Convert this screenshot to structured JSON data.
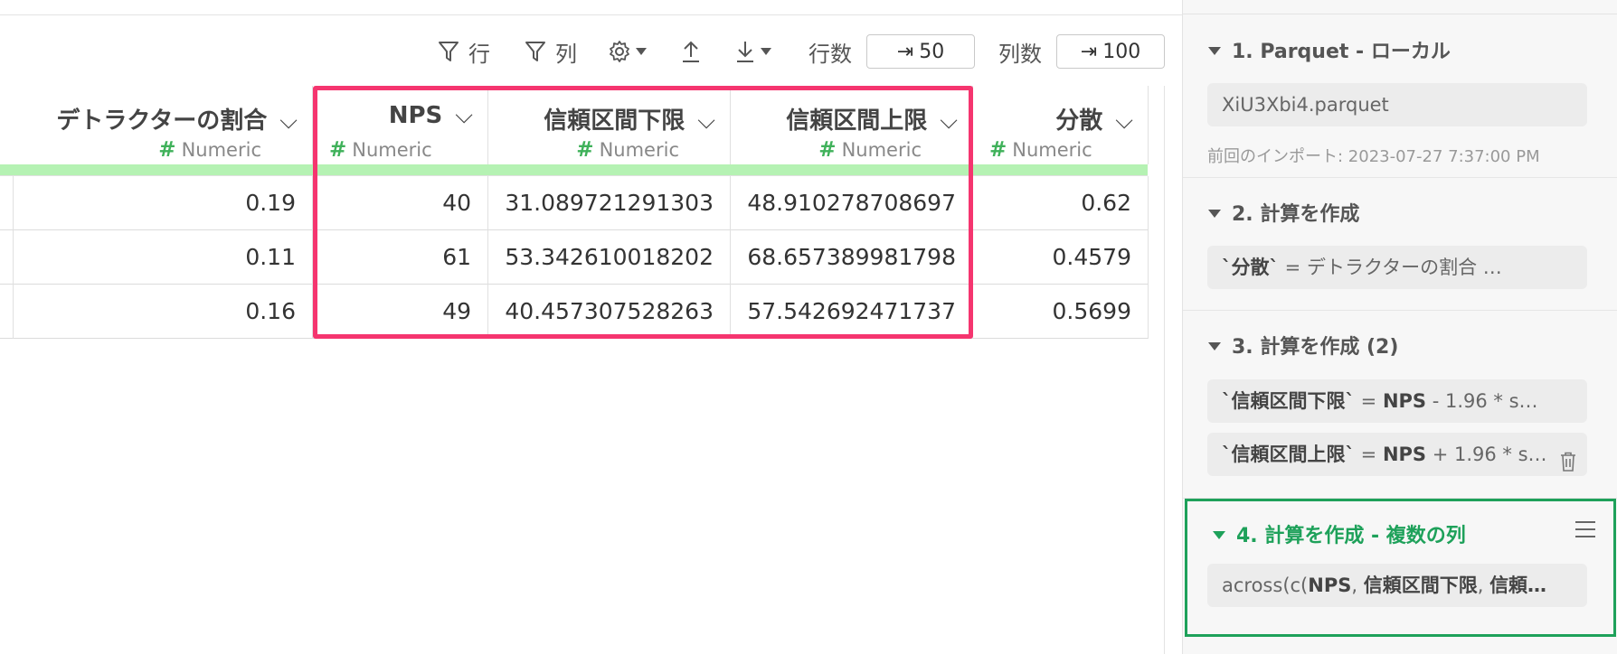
{
  "toolbar": {
    "row_filter_label": "行",
    "col_filter_label": "列",
    "rows_label": "行数",
    "rows_value": "50",
    "cols_label": "列数",
    "cols_value": "100",
    "icons": [
      "filter-icon",
      "filter-icon",
      "gear-icon",
      "caret-down-icon",
      "upload-icon",
      "download-icon",
      "caret-down-icon"
    ]
  },
  "table": {
    "columns": [
      {
        "name": "デトラクターの割合",
        "type": "Numeric"
      },
      {
        "name": "NPS",
        "type": "Numeric"
      },
      {
        "name": "信頼区間下限",
        "type": "Numeric"
      },
      {
        "name": "信頼区間上限",
        "type": "Numeric"
      },
      {
        "name": "分散",
        "type": "Numeric"
      }
    ],
    "rows": [
      [
        "0.19",
        "40",
        "31.089721291303",
        "48.910278708697",
        "0.62"
      ],
      [
        "0.11",
        "61",
        "53.342610018202",
        "68.657389981798",
        "0.4579"
      ],
      [
        "0.16",
        "49",
        "40.457307528263",
        "57.542692471737",
        "0.5699"
      ]
    ],
    "highlight_color": "#f5356f",
    "header_accent_color": "#b5f2b3"
  },
  "steps": {
    "s1": {
      "title": "1. Parquet - ローカル",
      "file": "XiU3Xbi4.parquet",
      "meta": "前回のインポート: 2023-07-27 7:37:00 PM"
    },
    "s2": {
      "title": "2. 計算を作成",
      "expr_a": "`分散`",
      "expr_b": " = デトラクターの割合 …"
    },
    "s3": {
      "title": "3. 計算を作成 (2)",
      "e1_a": "`信頼区間下限`",
      "e1_b": " = ",
      "e1_c": "NPS",
      "e1_d": " - 1.96 * s…",
      "e2_a": "`信頼区間上限`",
      "e2_b": " = ",
      "e2_c": "NPS",
      "e2_d": " + 1.96 * s…"
    },
    "s4": {
      "title": "4. 計算を作成 - 複数の列",
      "expr_a": "across(c(",
      "expr_b": "NPS",
      "expr_c": ", ",
      "expr_d": "信頼区間下限",
      "expr_e": ", ",
      "expr_f": "信頼…",
      "accent_color": "#1ea15a"
    }
  }
}
